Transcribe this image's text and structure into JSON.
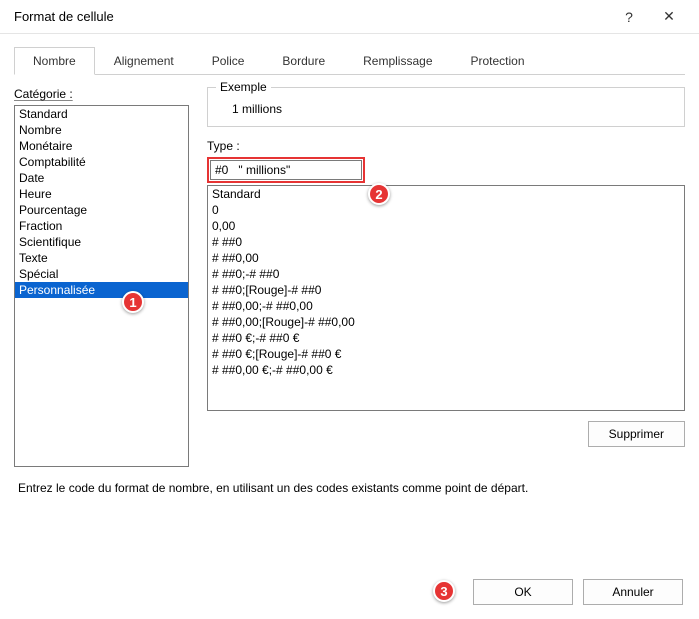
{
  "window": {
    "title": "Format de cellule",
    "help_glyph": "?",
    "close_glyph": "✕"
  },
  "tabs": [
    "Nombre",
    "Alignement",
    "Police",
    "Bordure",
    "Remplissage",
    "Protection"
  ],
  "active_tab_index": 0,
  "category": {
    "label": "Catégorie :",
    "items": [
      "Standard",
      "Nombre",
      "Monétaire",
      "Comptabilité",
      "Date",
      "Heure",
      "Pourcentage",
      "Fraction",
      "Scientifique",
      "Texte",
      "Spécial",
      "Personnalisée"
    ],
    "selected_index": 11
  },
  "example": {
    "legend": "Exemple",
    "value": "1 millions"
  },
  "type": {
    "label": "Type :",
    "value": "#0   \" millions\"",
    "formats": [
      "Standard",
      "0",
      "0,00",
      "# ##0",
      "# ##0,00",
      "# ##0;-# ##0",
      "# ##0;[Rouge]-# ##0",
      "# ##0,00;-# ##0,00",
      "# ##0,00;[Rouge]-# ##0,00",
      "# ##0 €;-# ##0 €",
      "# ##0 €;[Rouge]-# ##0 €",
      "# ##0,00 €;-# ##0,00 €"
    ]
  },
  "buttons": {
    "delete": "Supprimer",
    "ok": "OK",
    "cancel": "Annuler"
  },
  "help_text": "Entrez le code du format de nombre, en utilisant un des codes existants comme point de départ.",
  "callouts": {
    "c1": "1",
    "c2": "2",
    "c3": "3"
  }
}
